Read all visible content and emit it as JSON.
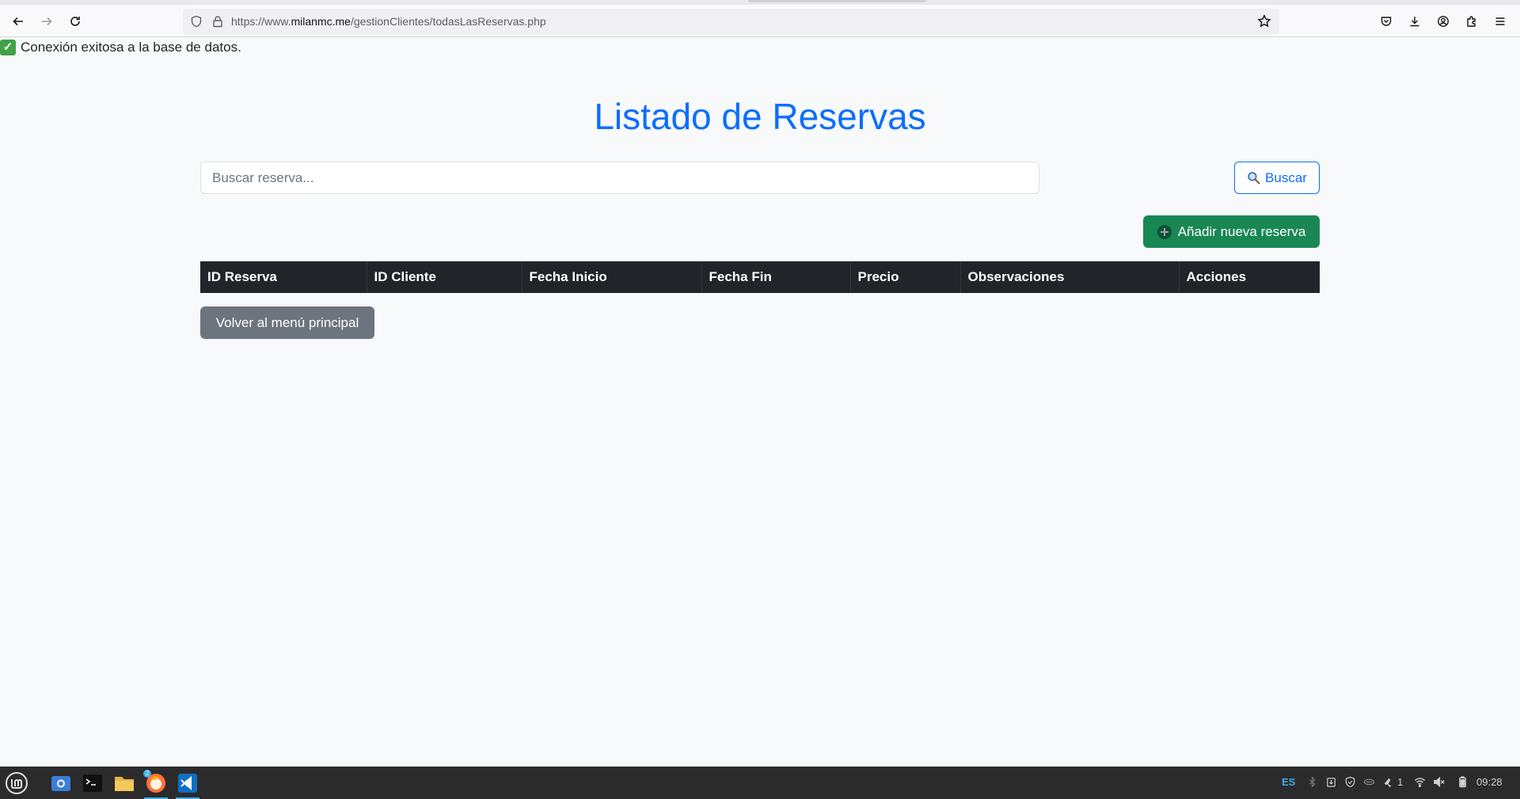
{
  "browser": {
    "url_prefix": "https://www.",
    "url_host": "milanmc.me",
    "url_path": "/gestionClientes/todasLasReservas.php"
  },
  "page": {
    "db_message": "Conexión exitosa a la base de datos.",
    "title": "Listado de Reservas",
    "search_placeholder": "Buscar reserva...",
    "search_button": "Buscar",
    "add_button": "Añadir nueva reserva",
    "back_button": "Volver al menú principal"
  },
  "table": {
    "columns": [
      "ID Reserva",
      "ID Cliente",
      "Fecha Inicio",
      "Fecha Fin",
      "Precio",
      "Observaciones",
      "Acciones"
    ],
    "rows": []
  },
  "taskbar": {
    "firefox_badge": "2",
    "language": "ES",
    "notification_count": "1",
    "clock": "09:28"
  },
  "colors": {
    "title": "#0d6efd",
    "add_button": "#198754",
    "back_button": "#6c757d",
    "table_header": "#212529"
  }
}
